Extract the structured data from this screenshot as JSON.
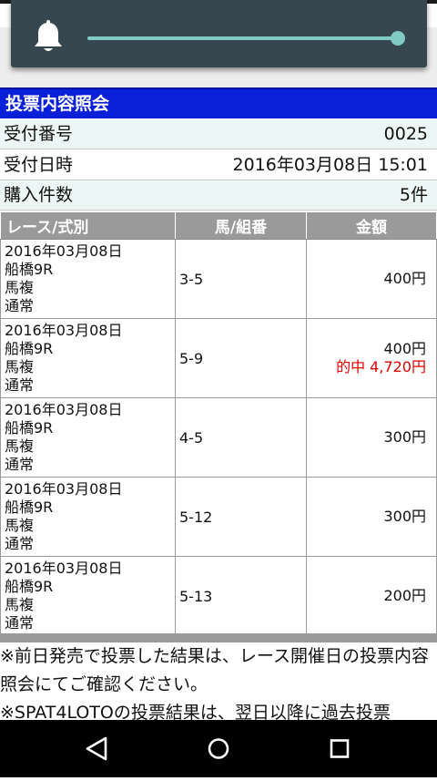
{
  "volume": {
    "level": 1.0,
    "accent": "#80cbc4",
    "icon": "bell-icon"
  },
  "page": {
    "title": "投票内容照会",
    "header_color": "#0a20d8"
  },
  "info": [
    {
      "label": "受付番号",
      "value": "0025"
    },
    {
      "label": "受付日時",
      "value": "2016年03月08日 15:01"
    },
    {
      "label": "購入件数",
      "value": "5件"
    }
  ],
  "table": {
    "headers": [
      "レース/式別",
      "馬/組番",
      "金額"
    ],
    "rows": [
      {
        "date": "2016年03月08日",
        "race": "船橋9R",
        "type": "馬複",
        "mode": "通常",
        "combo": "3-5",
        "amount": "400円",
        "hit": ""
      },
      {
        "date": "2016年03月08日",
        "race": "船橋9R",
        "type": "馬複",
        "mode": "通常",
        "combo": "5-9",
        "amount": "400円",
        "hit": "的中  4,720円"
      },
      {
        "date": "2016年03月08日",
        "race": "船橋9R",
        "type": "馬複",
        "mode": "通常",
        "combo": "4-5",
        "amount": "300円",
        "hit": ""
      },
      {
        "date": "2016年03月08日",
        "race": "船橋9R",
        "type": "馬複",
        "mode": "通常",
        "combo": "5-12",
        "amount": "300円",
        "hit": ""
      },
      {
        "date": "2016年03月08日",
        "race": "船橋9R",
        "type": "馬複",
        "mode": "通常",
        "combo": "5-13",
        "amount": "200円",
        "hit": ""
      }
    ]
  },
  "notes": [
    "※前日発売で投票した結果は、レース開催日の投票内容照会にてご確認ください。",
    "※SPAT4LOTOの投票結果は、翌日以降に過去投票"
  ],
  "nav": {
    "back": "back-icon",
    "home": "home-icon",
    "recents": "recents-icon"
  }
}
